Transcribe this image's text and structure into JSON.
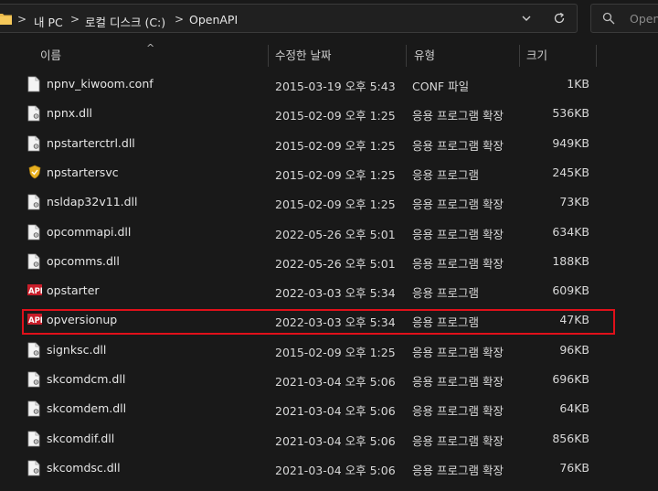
{
  "address_bar": {
    "crumbs": [
      "내 PC",
      "로컬 디스크 (C:)",
      "OpenAPI"
    ],
    "separator": ">"
  },
  "search": {
    "placeholder": "OpenAPI"
  },
  "columns": {
    "name": "이름",
    "date": "수정한 날짜",
    "type": "유형",
    "size": "크기"
  },
  "files": [
    {
      "name": "npnv_kiwoom.conf",
      "date": "2015-03-19 오후 5:43",
      "type": "CONF 파일",
      "size": "1KB",
      "icon": "file-icon"
    },
    {
      "name": "npnx.dll",
      "date": "2015-02-09 오후 1:25",
      "type": "응용 프로그램 확장",
      "size": "536KB",
      "icon": "dll-icon"
    },
    {
      "name": "npstarterctrl.dll",
      "date": "2015-02-09 오후 1:25",
      "type": "응용 프로그램 확장",
      "size": "949KB",
      "icon": "dll-icon"
    },
    {
      "name": "npstartersvc",
      "date": "2015-02-09 오후 1:25",
      "type": "응용 프로그램",
      "size": "245KB",
      "icon": "shield-app-icon"
    },
    {
      "name": "nsldap32v11.dll",
      "date": "2015-02-09 오후 1:25",
      "type": "응용 프로그램 확장",
      "size": "73KB",
      "icon": "dll-icon"
    },
    {
      "name": "opcommapi.dll",
      "date": "2022-05-26 오후 5:01",
      "type": "응용 프로그램 확장",
      "size": "634KB",
      "icon": "dll-icon"
    },
    {
      "name": "opcomms.dll",
      "date": "2022-05-26 오후 5:01",
      "type": "응용 프로그램 확장",
      "size": "188KB",
      "icon": "dll-icon"
    },
    {
      "name": "opstarter",
      "date": "2022-03-03 오후 5:34",
      "type": "응용 프로그램",
      "size": "609KB",
      "icon": "kiwoom-app-icon"
    },
    {
      "name": "opversionup",
      "date": "2022-03-03 오후 5:34",
      "type": "응용 프로그램",
      "size": "47KB",
      "icon": "kiwoom-app-icon"
    },
    {
      "name": "signksc.dll",
      "date": "2015-02-09 오후 1:25",
      "type": "응용 프로그램 확장",
      "size": "96KB",
      "icon": "dll-icon"
    },
    {
      "name": "skcomdcm.dll",
      "date": "2021-03-04 오후 5:06",
      "type": "응용 프로그램 확장",
      "size": "696KB",
      "icon": "dll-icon"
    },
    {
      "name": "skcomdem.dll",
      "date": "2021-03-04 오후 5:06",
      "type": "응용 프로그램 확장",
      "size": "64KB",
      "icon": "dll-icon"
    },
    {
      "name": "skcomdif.dll",
      "date": "2021-03-04 오후 5:06",
      "type": "응용 프로그램 확장",
      "size": "856KB",
      "icon": "dll-icon"
    },
    {
      "name": "skcomdsc.dll",
      "date": "2021-03-04 오후 5:06",
      "type": "응용 프로그램 확장",
      "size": "76KB",
      "icon": "dll-icon"
    }
  ],
  "highlighted_file": "opversionup",
  "colors": {
    "highlight_border": "#e0101a",
    "background": "#191919"
  }
}
